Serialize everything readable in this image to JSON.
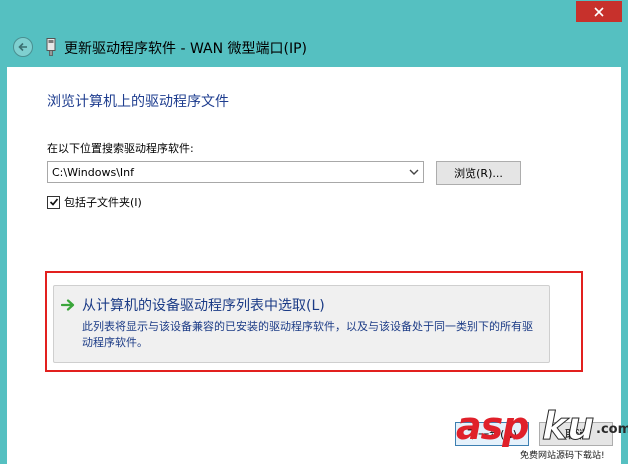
{
  "window": {
    "title": "更新驱动程序软件 - WAN 微型端口(IP)"
  },
  "main": {
    "heading": "浏览计算机上的驱动程序文件",
    "search_label": "在以下位置搜索驱动程序软件:",
    "path_value": "C:\\Windows\\Inf",
    "browse_label": "浏览(R)...",
    "include_subfolders_label": "包括子文件夹(I)",
    "include_subfolders_checked": true
  },
  "pick_option": {
    "title": "从计算机的设备驱动程序列表中选取(L)",
    "description": "此列表将显示与该设备兼容的已安装的驱动程序软件，以及与该设备处于同一类别下的所有驱动程序软件。"
  },
  "footer": {
    "next_label": "下一步(N)",
    "cancel_label": "取消"
  },
  "watermark": {
    "brand_part1": "asp",
    "brand_part2": "ku",
    "brand_suffix": ".com",
    "tagline": "免费网站源码下载站!"
  },
  "colors": {
    "frame": "#55c0c1",
    "close": "#c7312c",
    "heading_blue": "#1e3d8f",
    "highlight_red": "#e2201e",
    "arrow_green": "#3aa63a"
  },
  "icons": {
    "back": "back-arrow-icon",
    "device": "hardware-device-icon",
    "close": "close-icon",
    "dropdown": "chevron-down-icon",
    "check": "check-icon",
    "option_arrow": "green-arrow-right-icon"
  }
}
